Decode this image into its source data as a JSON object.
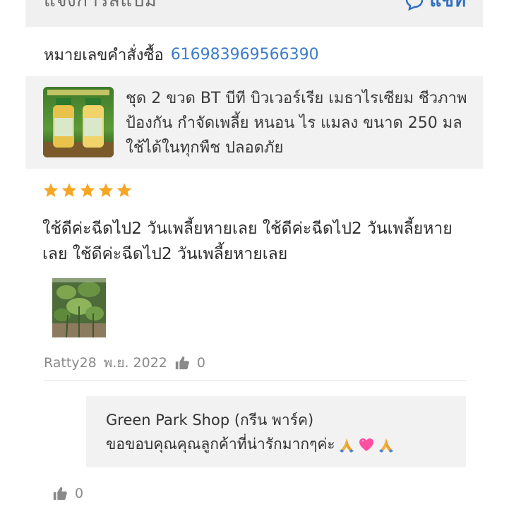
{
  "header": {
    "title": "แจ้งการสแปม",
    "action_label": "แชท"
  },
  "order": {
    "label": "หมายเลขคำสั่งซื้อ",
    "number": "616983969566390"
  },
  "product": {
    "title": "ชุด 2 ขวด BT บีที บิวเวอร์เรีย เมธาไรเซียม ชีวภาพ ป้องกัน กำจัดเพลี้ย หนอน ไร แมลง ขนาด 250 มล ใช้ได้ในทุกพืช ปลอดภัย"
  },
  "review": {
    "rating": 5,
    "rating_max": 5,
    "text": "ใช้ดีค่ะฉีดไป2 วันเพลี้ยหายเลย ใช้ดีค่ะฉีดไป2 วันเพลี้ยหายเลย ใช้ดีค่ะฉีดไป2 วันเพลี้ยหายเลย",
    "username": "Ratty28",
    "date": "พ.ย. 2022",
    "likes": "0"
  },
  "seller_reply": {
    "name": "Green Park Shop (กรีน พาร์ค)",
    "text": "ขอขอบคุณคุณลูกค้าที่น่ารักมากๆค่ะ",
    "emoji_icons": [
      "folded-hands-icon",
      "heart-icon",
      "folded-hands-icon"
    ],
    "likes": "0"
  },
  "colors": {
    "accent": "#3d7cc9",
    "star": "#f5a623",
    "panel": "#f2f2f2",
    "muted": "#8a8a8a"
  }
}
